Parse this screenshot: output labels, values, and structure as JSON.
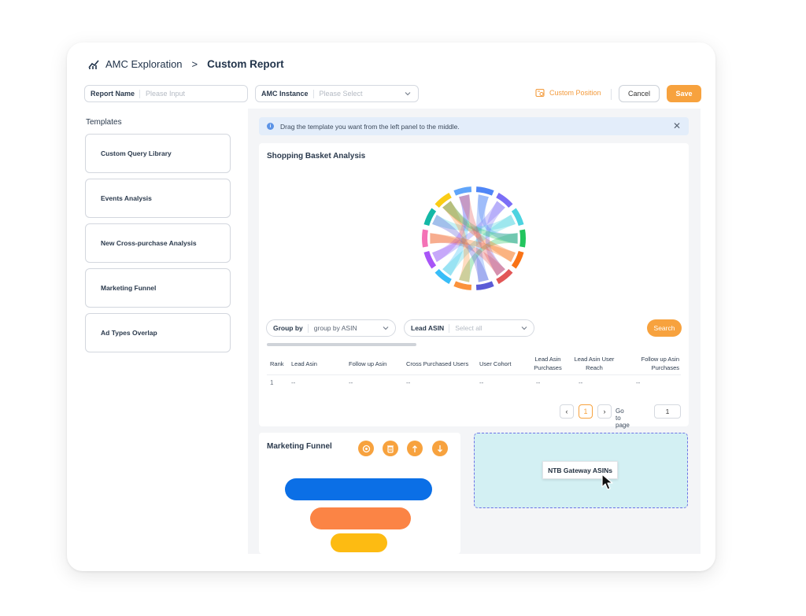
{
  "breadcrumb": {
    "root": "AMC Exploration",
    "separator": ">",
    "current": "Custom Report"
  },
  "toolbar": {
    "report_name_label": "Report Name",
    "report_name_placeholder": "Please Input",
    "amc_instance_label": "AMC Instance",
    "amc_instance_placeholder": "Please Select",
    "custom_position": "Custom Position",
    "cancel": "Cancel",
    "save": "Save"
  },
  "templates": {
    "title": "Templates",
    "items": [
      {
        "label": "Custom Query Library"
      },
      {
        "label": "Events Analysis"
      },
      {
        "label": "New Cross-purchase Analysis"
      },
      {
        "label": "Marketing Funnel"
      },
      {
        "label": "Ad Types Overlap"
      }
    ]
  },
  "tip": {
    "text": "Drag the template you want from the left panel to the middle."
  },
  "shopping_basket": {
    "title": "Shopping Basket Analysis",
    "group_by_label": "Group by",
    "group_by_value": "group by ASIN",
    "lead_asin_label": "Lead ASIN",
    "lead_asin_placeholder": "Select all",
    "search": "Search",
    "columns": [
      "Rank",
      "Lead Asin",
      "Follow up Asin",
      "Cross Purchased Users",
      "User Cohort",
      "Lead Asin Purchases",
      "Lead Asin User Reach",
      "Follow up Asin Purchases"
    ],
    "rows": [
      [
        "1",
        "--",
        "--",
        "--",
        "--",
        "--",
        "--",
        "--"
      ]
    ],
    "pagination": {
      "prev": "‹",
      "page": "1",
      "next": "›",
      "goto_label": "Go to page",
      "goto_value": "1"
    }
  },
  "marketing_funnel": {
    "title": "Marketing Funnel",
    "actions": [
      "settings-icon",
      "trash-icon",
      "arrow-up-icon",
      "arrow-down-icon"
    ]
  },
  "drop_zone": {
    "card_label": "NTB Gateway ASINs"
  },
  "colors": {
    "accent": "#f7a23e",
    "funnel": [
      "#0b6fe6",
      "#fb8445",
      "#fdbb12"
    ],
    "drop_border": "#6d71e6",
    "drop_bg": "#d3f0f3"
  }
}
